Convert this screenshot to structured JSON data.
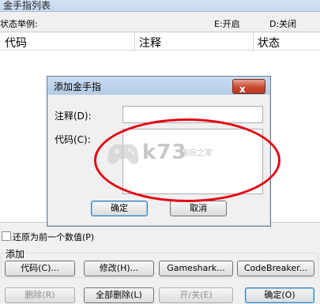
{
  "main_window": {
    "title": "金手指列表",
    "status_example_label": "状态举例:",
    "status_on": "E:开启",
    "status_off": "D:关闭"
  },
  "list": {
    "columns": [
      "代码",
      "注释",
      "状态"
    ]
  },
  "dialog": {
    "title": "添加金手指",
    "close_label": "x",
    "comment_label": "注释(D):",
    "code_label": "代码(C):",
    "ok_label": "确定",
    "cancel_label": "取消"
  },
  "restore_checkbox": {
    "label": "还原为前一个数值(P)",
    "checked": false
  },
  "add_group": {
    "label": "添加",
    "buttons": [
      "代码(C)...",
      "修改(H)...",
      "Gameshark...",
      "CodeBreaker..."
    ]
  },
  "bottom_buttons": {
    "delete": "删除(R)",
    "delete_all": "全部删除(L)",
    "toggle": "开/关(E)",
    "ok": "确定(O)"
  },
  "watermark": {
    "text": "k73",
    "subtext": "电玩之家"
  }
}
